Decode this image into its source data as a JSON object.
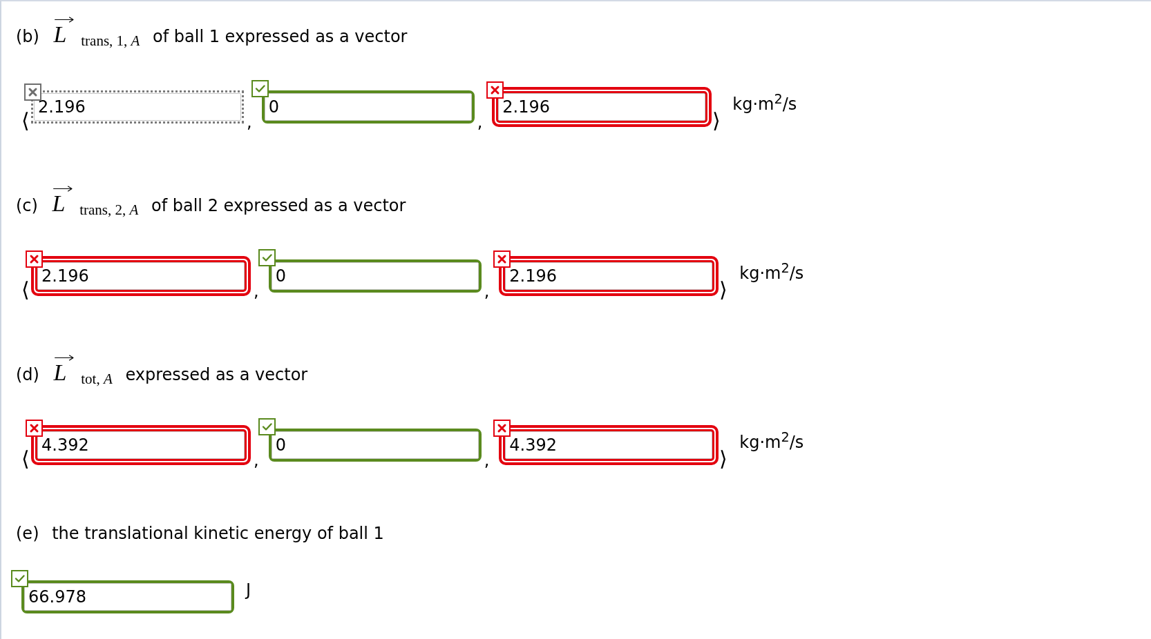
{
  "parts": [
    {
      "label": "(b)",
      "symbol": {
        "base": "L",
        "subscript": "trans, 1, *A*"
      },
      "text": "of ball 1 expressed as a vector",
      "kind": "vector",
      "open": "⟨",
      "fields": [
        {
          "value": "2.196",
          "correct": false,
          "disabled": true,
          "separator": ","
        },
        {
          "value": "0",
          "correct": true,
          "disabled": false,
          "separator": ","
        },
        {
          "value": "2.196",
          "correct": false,
          "disabled": false
        }
      ],
      "close": "⟩",
      "unit": "kg·m$^{2}$/s"
    },
    {
      "label": "(c)",
      "symbol": {
        "base": "L",
        "subscript": "trans, 2, *A*"
      },
      "text": "of ball 2 expressed as a vector",
      "kind": "vector",
      "open": "⟨",
      "fields": [
        {
          "value": "2.196",
          "correct": false,
          "disabled": false,
          "separator": ","
        },
        {
          "value": "0",
          "correct": true,
          "disabled": false,
          "separator": ","
        },
        {
          "value": "2.196",
          "correct": false,
          "disabled": false
        }
      ],
      "close": "⟩",
      "unit": "kg·m$^{2}$/s"
    },
    {
      "label": "(d)",
      "symbol": {
        "base": "L",
        "subscript": "tot, *A*"
      },
      "text": "expressed as a vector",
      "kind": "vector",
      "open": "⟨",
      "fields": [
        {
          "value": "4.392",
          "correct": false,
          "disabled": false,
          "separator": ","
        },
        {
          "value": "0",
          "correct": true,
          "disabled": false,
          "separator": ","
        },
        {
          "value": "4.392",
          "correct": false,
          "disabled": false
        }
      ],
      "close": "⟩",
      "unit": "kg·m$^{2}$/s"
    },
    {
      "label": "(e)",
      "text": "the translational kinetic energy of ball 1",
      "kind": "scalar",
      "fields": [
        {
          "value": "66.978",
          "correct": true,
          "disabled": false
        }
      ],
      "unit": "J"
    }
  ]
}
